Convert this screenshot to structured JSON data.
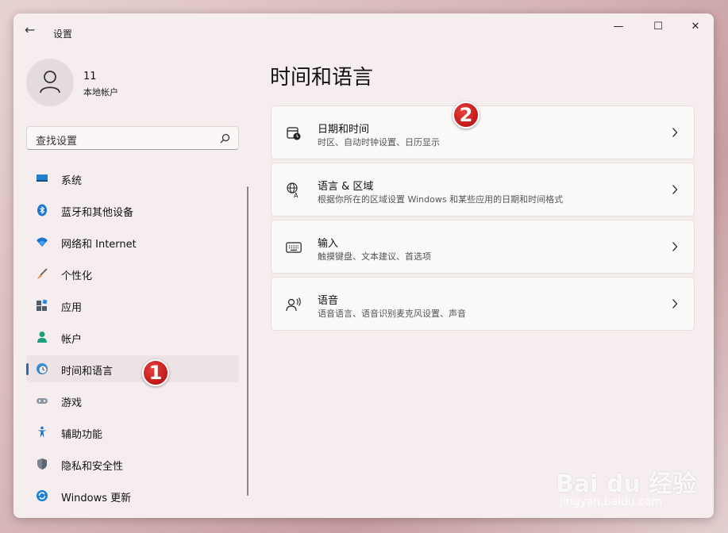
{
  "window": {
    "title": "设置",
    "back": "←"
  },
  "controls": {
    "minimize": "—",
    "maximize": "☐",
    "close": "✕"
  },
  "user": {
    "name": "11",
    "type": "本地帐户"
  },
  "search": {
    "placeholder": "查找设置"
  },
  "sidebar": {
    "items": [
      {
        "label": "系统",
        "icon": "monitor-icon"
      },
      {
        "label": "蓝牙和其他设备",
        "icon": "bluetooth-icon"
      },
      {
        "label": "网络和 Internet",
        "icon": "wifi-icon"
      },
      {
        "label": "个性化",
        "icon": "brush-icon"
      },
      {
        "label": "应用",
        "icon": "apps-icon"
      },
      {
        "label": "帐户",
        "icon": "person-icon"
      },
      {
        "label": "时间和语言",
        "icon": "globe-clock-icon",
        "selected": true
      },
      {
        "label": "游戏",
        "icon": "gamepad-icon"
      },
      {
        "label": "辅助功能",
        "icon": "accessibility-icon"
      },
      {
        "label": "隐私和安全性",
        "icon": "shield-icon"
      },
      {
        "label": "Windows 更新",
        "icon": "update-icon"
      }
    ]
  },
  "main": {
    "title": "时间和语言",
    "cards": [
      {
        "title": "日期和时间",
        "desc": "时区、自动时钟设置、日历显示",
        "icon": "calendar-clock-icon"
      },
      {
        "title": "语言 & 区域",
        "desc": "根据你所在的区域设置 Windows 和某些应用的日期和时间格式",
        "icon": "language-icon"
      },
      {
        "title": "输入",
        "desc": "触摸键盘、文本建议、首选项",
        "icon": "keyboard-icon"
      },
      {
        "title": "语音",
        "desc": "语音语言、语音识别麦克风设置、声音",
        "icon": "speech-icon"
      }
    ]
  },
  "annotations": {
    "step1": "1",
    "step2": "2"
  },
  "watermark": {
    "brand": "Bai du 经验",
    "url": "jingyan.baidu.com"
  },
  "colors": {
    "accent": "#2a6db3",
    "badge": "#c0191a",
    "window_bg": "#f6eeee"
  }
}
